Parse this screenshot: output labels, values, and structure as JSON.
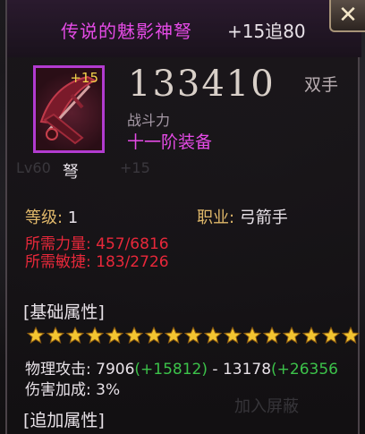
{
  "item": {
    "name": "传说的魅影神弩",
    "enhance": "+15追80",
    "icon_plus": "+15",
    "icon": "crossbow-icon",
    "power": "133410",
    "handedness": "双手",
    "power_label": "战斗力",
    "tier": "十一阶装备",
    "type": "弩"
  },
  "info": {
    "level_label": "等级: ",
    "level_value": "1",
    "job_label": "职业: ",
    "job_value": "弓箭手"
  },
  "requirements": {
    "str": "所需力量: 457/6816",
    "dex": "所需敏捷: 183/2726"
  },
  "base_section": {
    "title": "[基础属性]",
    "stars": 17,
    "attack_label": "物理攻击: ",
    "attack_min": "7906",
    "attack_min_bonus": "(+15812)",
    "attack_sep": " - ",
    "attack_max": "13178",
    "attack_max_bonus": "(+26356",
    "damage_bonus": "伤害加成: 3%"
  },
  "extra_section": {
    "title": "[追加属性]"
  },
  "close": {
    "icon": "close-icon",
    "glyph": "✕"
  },
  "background": {
    "level_hint": "Lv60",
    "plus_hint": "+15",
    "button_hint": "加入屏蔽"
  },
  "colors": {
    "title": "#e54be6",
    "rarity_border": "#b23bd0",
    "label": "#e0b86a",
    "requirement": "#e8283a",
    "bonus": "#3cc24a",
    "star": "#f3c531"
  }
}
